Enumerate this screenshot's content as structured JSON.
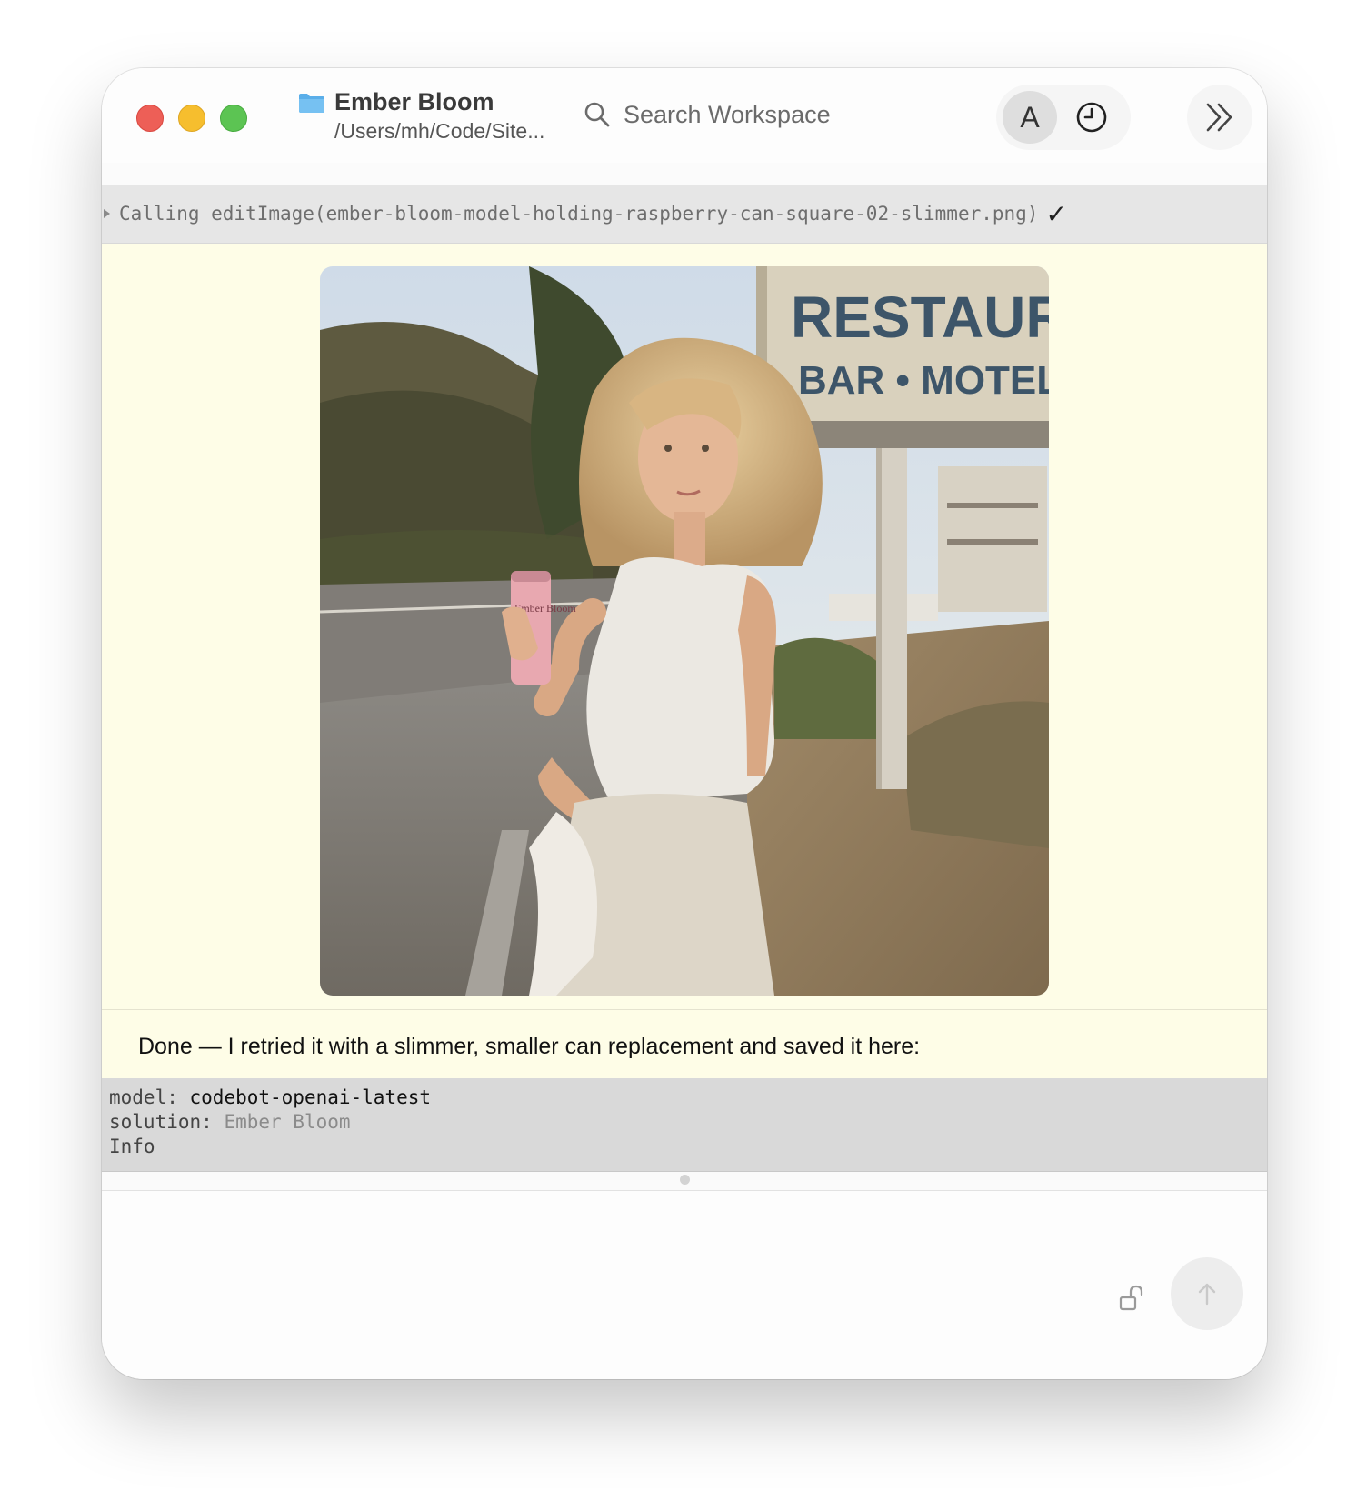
{
  "window": {
    "project_title": "Ember Bloom",
    "project_path": "/Users/mh/Code/Site...",
    "search_placeholder": "Search Workspace",
    "avatar_letter": "A"
  },
  "tool_call": {
    "text": "Calling editImage(ember-bloom-model-holding-raspberry-can-square-02-slimmer.png)",
    "status_glyph": "✓"
  },
  "image": {
    "sign_line1": "RESTAURA",
    "sign_line2": "BAR • MOTEL",
    "can_brand": "Ember Bloom"
  },
  "message": {
    "text": "Done — I retried it with a slimmer, smaller can replacement and saved it here:"
  },
  "info": {
    "model_key": "model:",
    "model_value": "codebot-openai-latest",
    "solution_key": "solution:",
    "solution_value": "Ember Bloom",
    "info_label": "Info"
  },
  "icons": {
    "folder": "folder-icon",
    "search": "search-icon",
    "history": "clock-icon",
    "sidebar": "chevrons-right-icon",
    "lock": "unlock-icon",
    "send": "arrow-up-icon"
  },
  "colors": {
    "accent_folder": "#5aaee9",
    "message_bg": "#fefde7",
    "tool_bg": "#e6e6e6",
    "info_bg": "#d9d9d9"
  }
}
